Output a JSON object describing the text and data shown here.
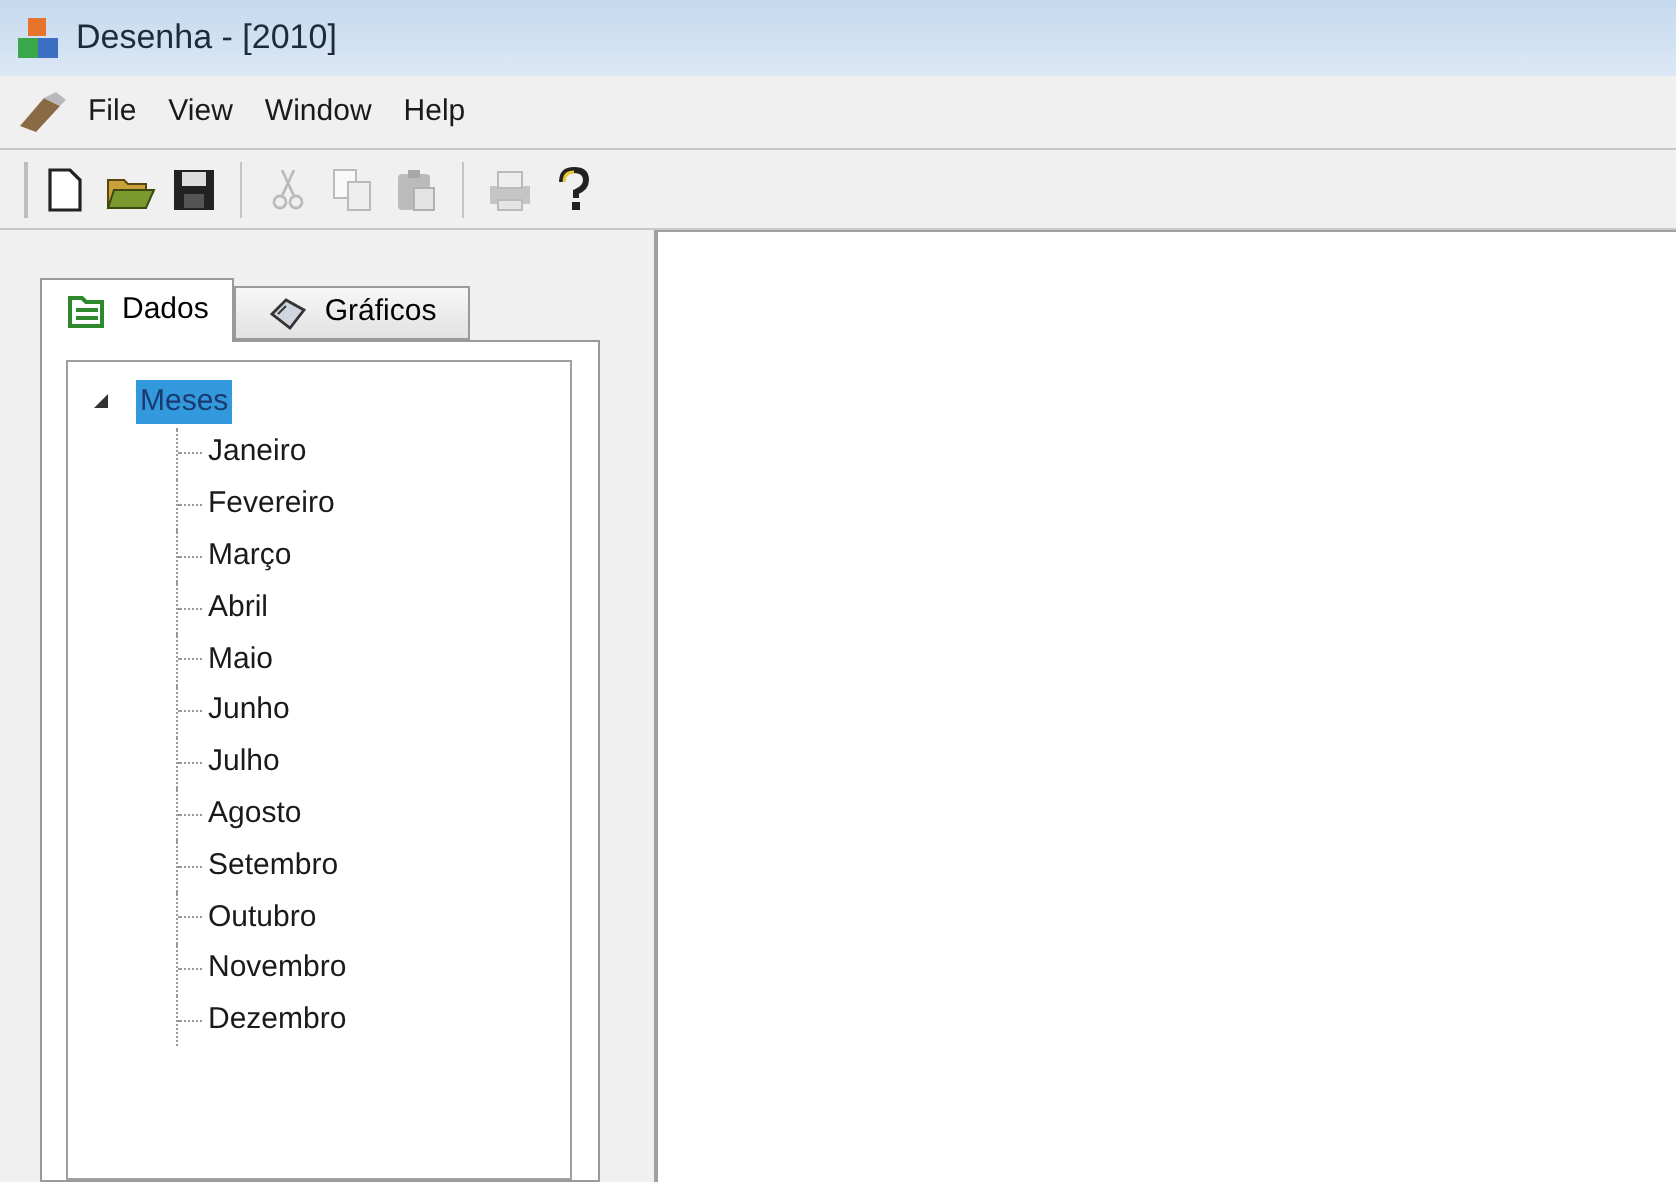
{
  "window": {
    "title": "Desenha - [2010]"
  },
  "menu": [
    "File",
    "View",
    "Window",
    "Help"
  ],
  "toolbar": [
    {
      "kind": "new",
      "disabled": false
    },
    {
      "kind": "open",
      "disabled": false
    },
    {
      "kind": "save",
      "disabled": false
    },
    {
      "kind": "separator"
    },
    {
      "kind": "cut",
      "disabled": true
    },
    {
      "kind": "copy",
      "disabled": true
    },
    {
      "kind": "paste",
      "disabled": true
    },
    {
      "kind": "separator"
    },
    {
      "kind": "print",
      "disabled": true
    },
    {
      "kind": "help",
      "disabled": false
    }
  ],
  "tabs": [
    {
      "label": "Dados",
      "kind": "data",
      "selected": true
    },
    {
      "label": "Gráficos",
      "kind": "charts",
      "selected": false
    }
  ],
  "tree": [
    {
      "label": "Meses",
      "selected": true,
      "expanded": true,
      "children": [
        {
          "label": "Janeiro",
          "selected": false
        },
        {
          "label": "Fevereiro",
          "selected": false
        },
        {
          "label": "Março",
          "selected": false
        },
        {
          "label": "Abril",
          "selected": false
        },
        {
          "label": "Maio",
          "selected": false
        },
        {
          "label": "Junho",
          "selected": false
        },
        {
          "label": "Julho",
          "selected": false
        },
        {
          "label": "Agosto",
          "selected": false
        },
        {
          "label": "Setembro",
          "selected": false
        },
        {
          "label": "Outubro",
          "selected": false
        },
        {
          "label": "Novembro",
          "selected": false
        },
        {
          "label": "Dezembro",
          "selected": false
        }
      ]
    }
  ]
}
